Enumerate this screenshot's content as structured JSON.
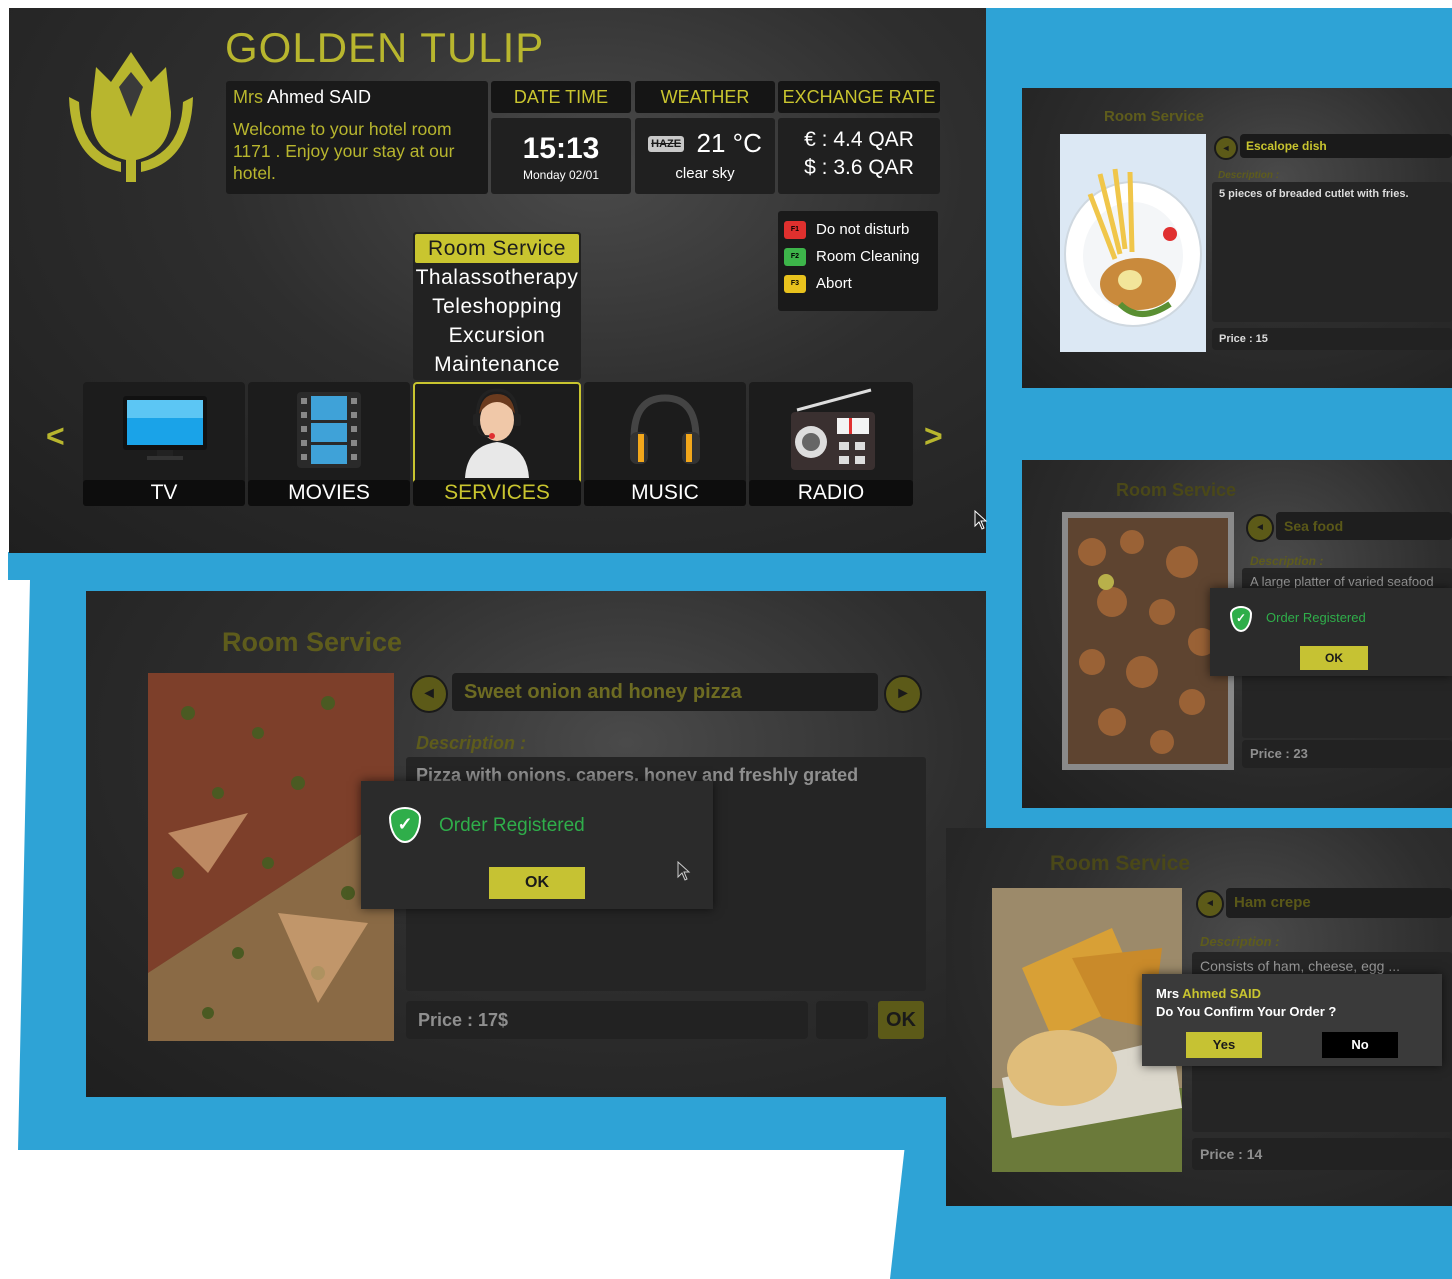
{
  "brand": {
    "name": "GOLDEN TULIP",
    "accent": "#c9c52f",
    "blue": "#2ea3d6"
  },
  "guest": {
    "title": "Mrs",
    "name": "Ahmed SAID",
    "welcome": "Welcome to your hotel room 1171 . Enjoy your stay at our hotel."
  },
  "header_tabs": [
    "DATE TIME",
    "WEATHER",
    "EXCHANGE RATE"
  ],
  "datetime": {
    "time": "15:13",
    "date": "Monday 02/01"
  },
  "weather": {
    "icon": "haze-icon",
    "icon_text": "HAZE",
    "temp": "21 °C",
    "condition": "clear sky"
  },
  "exchange": {
    "eur": "€ : 4.4 QAR",
    "usd": "$ : 3.6 QAR"
  },
  "legend": [
    {
      "key": "F1",
      "color": "#e0302e",
      "label": "Do not disturb"
    },
    {
      "key": "F2",
      "color": "#3db54a",
      "label": "Room Cleaning"
    },
    {
      "key": "F3",
      "color": "#e8c21d",
      "label": "Abort"
    }
  ],
  "services_menu": [
    {
      "label": "Room Service",
      "selected": true
    },
    {
      "label": "Thalassotherapy"
    },
    {
      "label": "Teleshopping"
    },
    {
      "label": "Excursion"
    },
    {
      "label": "Maintenance"
    }
  ],
  "nav": {
    "prev": "<",
    "next": ">"
  },
  "tiles": [
    {
      "label": "TV",
      "icon": "tv-icon"
    },
    {
      "label": "MOVIES",
      "icon": "film-icon"
    },
    {
      "label": "SERVICES",
      "icon": "concierge-icon",
      "selected": true
    },
    {
      "label": "MUSIC",
      "icon": "headphones-icon"
    },
    {
      "label": "RADIO",
      "icon": "radio-icon"
    }
  ],
  "pizza": {
    "title": "Room Service",
    "dish": "Sweet onion and honey pizza",
    "desc_label": "Description :",
    "desc": "Pizza with onions, capers, honey and freshly grated",
    "popup_text": "Order Registered",
    "popup_ok": "OK",
    "price": "Price : 17$",
    "ok": "OK"
  },
  "escalope": {
    "title": "Room Service",
    "dish": "Escalope dish",
    "desc_label": "Description :",
    "desc": "5 pieces of breaded cutlet with fries.",
    "price": "Price : 15"
  },
  "seafood": {
    "title": "Room Service",
    "dish": "Sea food",
    "desc_label": "Description :",
    "desc": "A large platter of varied seafood",
    "popup_text": "Order Registered",
    "popup_ok": "OK",
    "price": "Price : 23"
  },
  "crepe": {
    "title": "Room Service",
    "dish": "Ham crepe",
    "desc_label": "Description :",
    "desc": "Consists of ham, cheese, egg ...",
    "confirm_title": "Mrs",
    "confirm_name": "Ahmed SAID",
    "confirm_question": "Do You Confirm Your Order ?",
    "yes": "Yes",
    "no": "No",
    "price": "Price : 14"
  }
}
